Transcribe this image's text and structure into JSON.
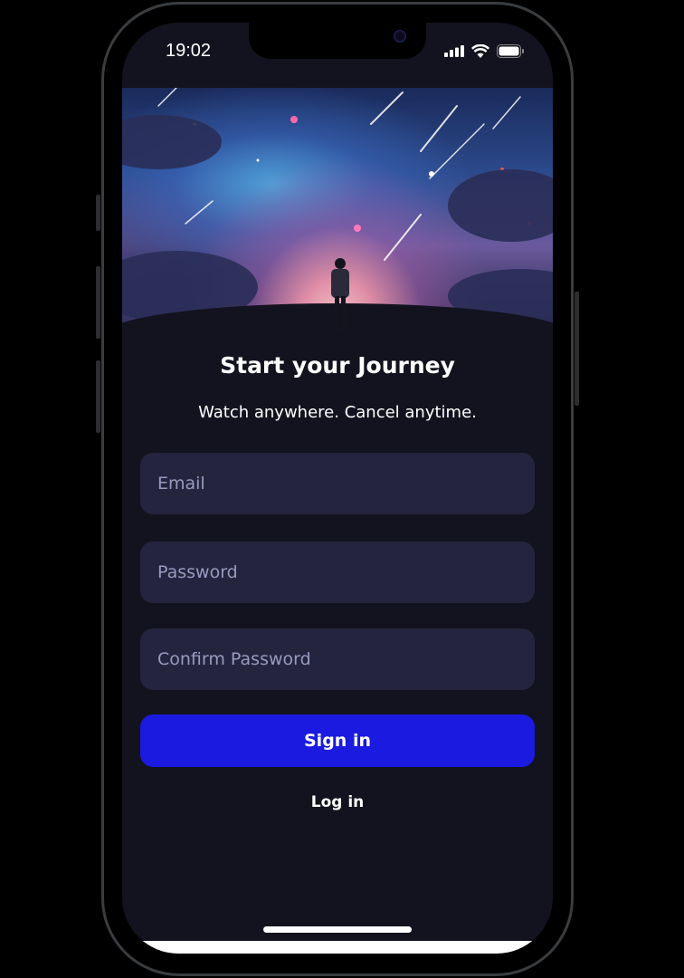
{
  "status_bar": {
    "time": "19:02",
    "icons": [
      "signal-icon",
      "wifi-icon",
      "battery-icon"
    ]
  },
  "hero": {
    "image": "anime-starry-sky-hero"
  },
  "header": {
    "title": "Start your Journey",
    "subtitle": "Watch anywhere. Cancel anytime."
  },
  "form": {
    "email": {
      "value": "",
      "placeholder": "Email"
    },
    "password": {
      "value": "",
      "placeholder": "Password"
    },
    "confirm_password": {
      "value": "",
      "placeholder": "Confirm Password"
    },
    "submit_label": "Sign in",
    "login_label": "Log in"
  },
  "colors": {
    "background": "#13131f",
    "field": "#24243f",
    "accent": "#1a1ae0"
  }
}
